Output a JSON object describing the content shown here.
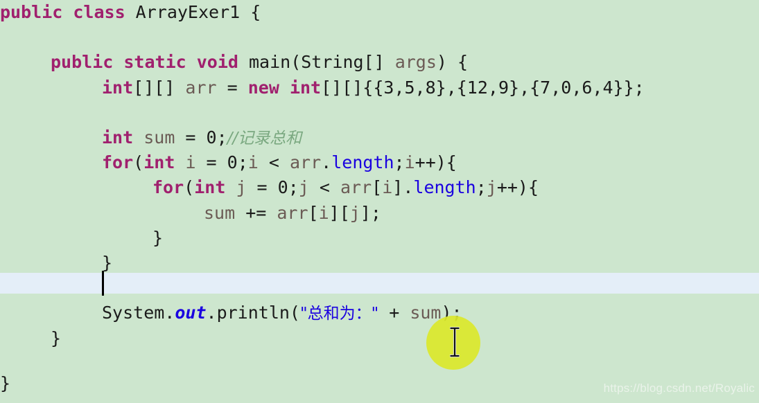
{
  "editor": {
    "background_color": "#cde6ce",
    "current_line_highlight_color": "#e4eef8",
    "font_size_px": 25,
    "line_height_px": 36.2
  },
  "colors": {
    "keyword": "#a0206e",
    "plain": "#1a1a1a",
    "variable": "#6b5b55",
    "field": "#1a00e0",
    "string": "#1a00e0",
    "comment": "#7aa880",
    "click_halo": "#dbe82b",
    "watermark": "#eaf3ea"
  },
  "code": {
    "line_01": {
      "t1": "public class ",
      "t2": "ArrayExer1 {"
    },
    "line_03": {
      "t1": "public static void ",
      "t2": "main(String[] ",
      "t3": "args",
      "t4": ") {"
    },
    "line_04": {
      "t1": "int",
      "t2": "[][] ",
      "t3": "arr",
      "t4": " = ",
      "t5": "new int",
      "t6": "[][]{{3,5,8},{12,9},{7,0,6,4}};"
    },
    "line_06": {
      "t1": "int ",
      "t2": "sum",
      "t3": " = ",
      "t4": "0",
      "t5": ";",
      "t6": "//记录总和"
    },
    "line_07": {
      "t1": "for",
      "t2": "(",
      "t3": "int ",
      "t4": "i",
      "t5": " = ",
      "t6": "0",
      "t7": ";",
      "t8": "i",
      "t9": " < ",
      "t10": "arr",
      "t11": ".",
      "t12": "length",
      "t13": ";",
      "t14": "i",
      "t15": "++){"
    },
    "line_08": {
      "t1": "for",
      "t2": "(",
      "t3": "int ",
      "t4": "j",
      "t5": " = ",
      "t6": "0",
      "t7": ";",
      "t8": "j",
      "t9": " < ",
      "t10": "arr",
      "t11": "[",
      "t12": "i",
      "t13": "].",
      "t14": "length",
      "t15": ";",
      "t16": "j",
      "t17": "++){"
    },
    "line_09": {
      "t1": "sum",
      "t2": " += ",
      "t3": "arr",
      "t4": "[",
      "t5": "i",
      "t6": "][",
      "t7": "j",
      "t8": "];"
    },
    "line_10": {
      "t1": "}"
    },
    "line_11": {
      "t1": "}"
    },
    "line_12": {
      "t1": ""
    },
    "line_13": {
      "t1": "System.",
      "t2": "out",
      "t3": ".println(",
      "t4": "\"总和为：\"",
      "t5": " + ",
      "t6": "sum",
      "t7": ");"
    },
    "line_14": {
      "t1": "}"
    },
    "line_16": {
      "t1": "}"
    }
  },
  "overlay": {
    "watermark": "https://blog.csdn.net/Royalic",
    "cursor_type": "ibeam-text-cursor",
    "click_indicator": "yellow-circle-highlight"
  }
}
